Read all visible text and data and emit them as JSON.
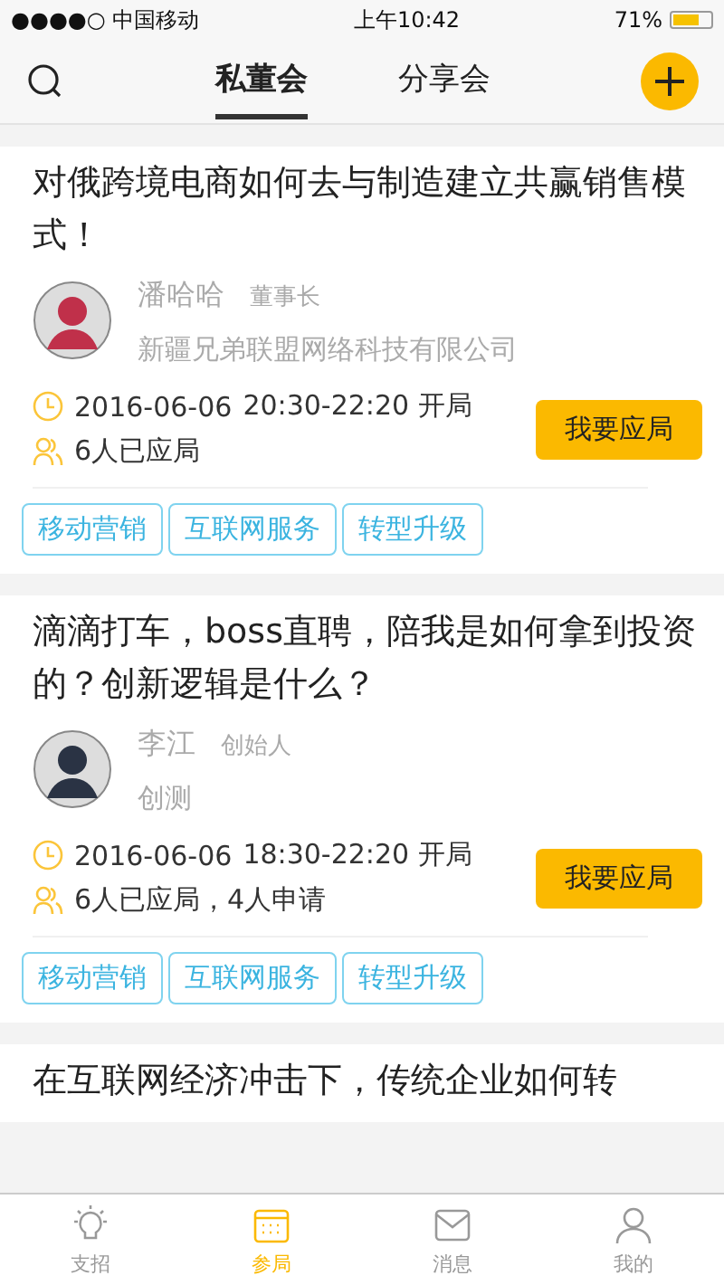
{
  "status_bar": {
    "carrier": "●●●●○ 中国移动",
    "time": "上午10:42",
    "battery": "71%"
  },
  "header": {
    "tabs": [
      {
        "label": "私董会",
        "selected": true
      },
      {
        "label": "分享会",
        "selected": false
      }
    ]
  },
  "cards": [
    {
      "title": "对俄跨境电商如何去与制造建立共赢销售模式！",
      "host": {
        "name": "潘哈哈",
        "role": "董事长",
        "company": "新疆兄弟联盟网络科技有限公司"
      },
      "date": "2016-06-06",
      "time": "20:30-22:20 开局",
      "attendance": "6人已应局",
      "button": "我要应局",
      "tags": [
        "移动营销",
        "互联网服务",
        "转型升级"
      ]
    },
    {
      "title": "滴滴打车，boss直聘，陪我是如何拿到投资的？创新逻辑是什么？",
      "host": {
        "name": "李江",
        "role": "创始人",
        "company": "创测"
      },
      "date": "2016-06-06",
      "time": "18:30-22:20 开局",
      "attendance": "6人已应局，4人申请",
      "button": "我要应局",
      "tags": [
        "移动营销",
        "互联网服务",
        "转型升级"
      ]
    },
    {
      "title": "在互联网经济冲击下，传统企业如何转"
    }
  ],
  "tab_bar": [
    {
      "label": "支招",
      "selected": false
    },
    {
      "label": "参局",
      "selected": true
    },
    {
      "label": "消息",
      "selected": false
    },
    {
      "label": "我的",
      "selected": false
    }
  ]
}
